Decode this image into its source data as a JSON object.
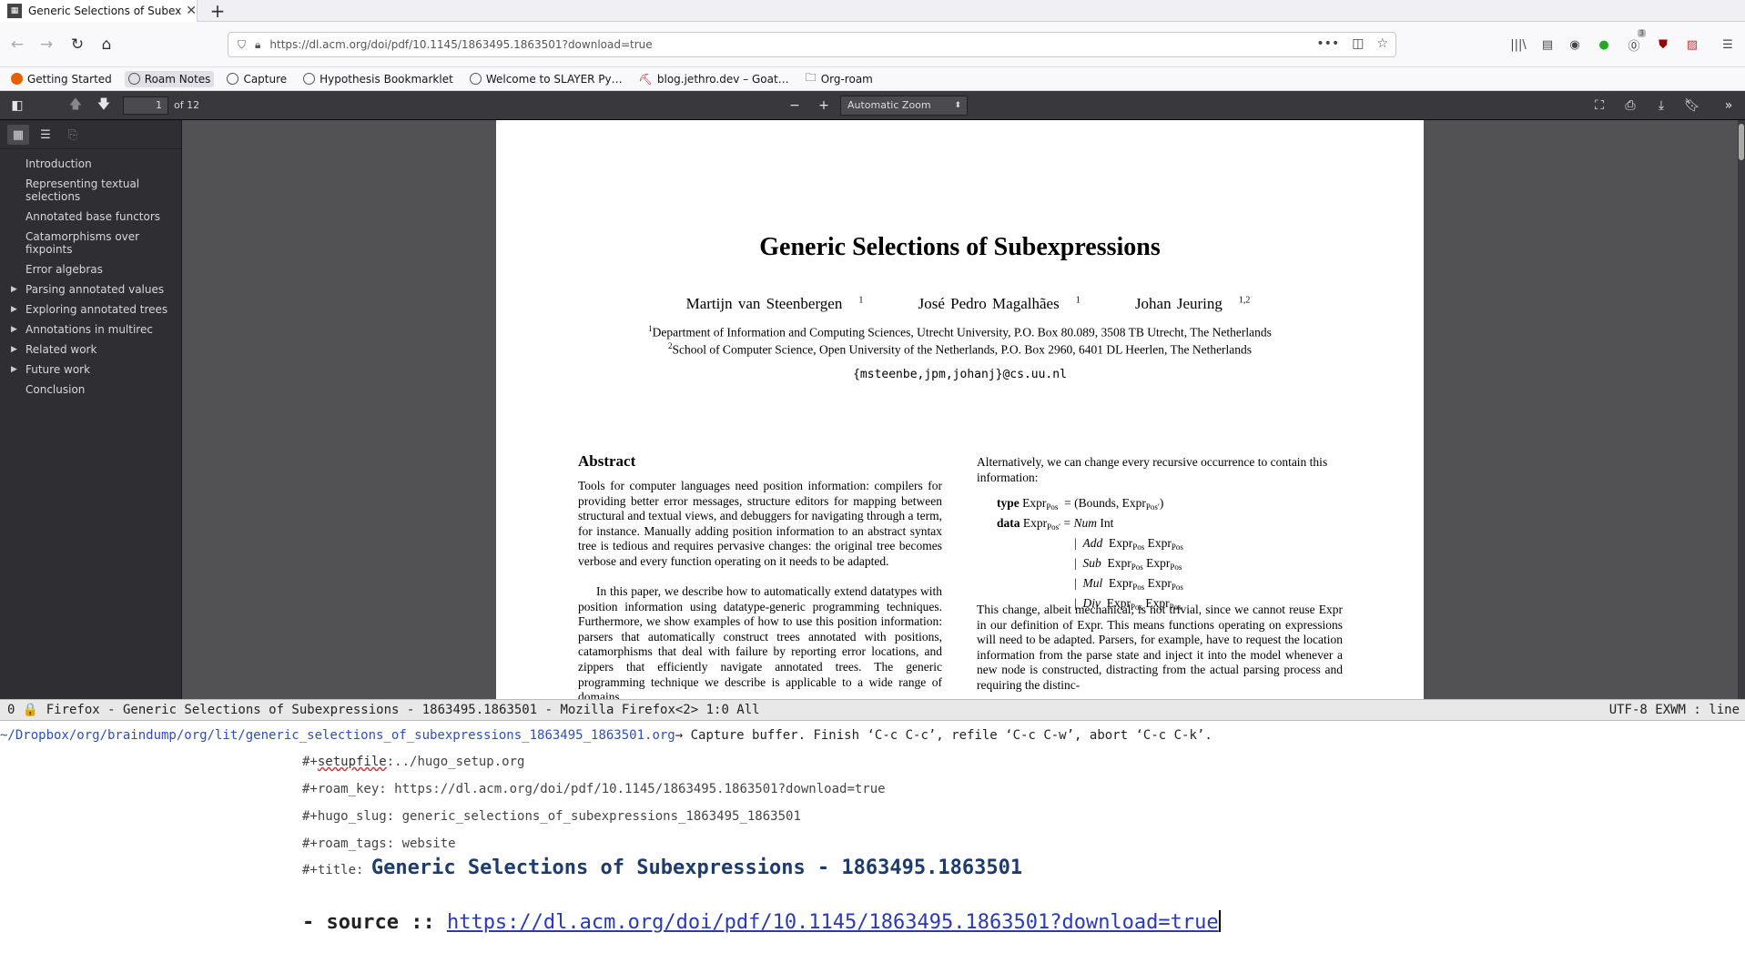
{
  "browser": {
    "tab_title": "Generic Selections of Subexpre",
    "url": "https://dl.acm.org/doi/pdf/10.1145/1863495.1863501?download=true",
    "bookmarks": [
      "Getting Started",
      "Roam Notes",
      "Capture",
      "Hypothesis Bookmarklet",
      "Welcome to SLAYER Py…",
      "blog.jethro.dev – Goat…",
      "Org-roam"
    ],
    "badge_count": "3"
  },
  "pdf": {
    "page_number": "1",
    "page_of": "of 12",
    "zoom": "Automatic Zoom",
    "outline": [
      {
        "label": "Introduction",
        "expandable": false
      },
      {
        "label": "Representing textual selections",
        "expandable": false
      },
      {
        "label": "Annotated base functors",
        "expandable": false
      },
      {
        "label": "Catamorphisms over fixpoints",
        "expandable": false
      },
      {
        "label": "Error algebras",
        "expandable": false
      },
      {
        "label": "Parsing annotated values",
        "expandable": true
      },
      {
        "label": "Exploring annotated trees",
        "expandable": true
      },
      {
        "label": "Annotations in multirec",
        "expandable": true
      },
      {
        "label": "Related work",
        "expandable": true
      },
      {
        "label": "Future work",
        "expandable": true
      },
      {
        "label": "Conclusion",
        "expandable": false
      }
    ],
    "paper": {
      "title": "Generic Selections of Subexpressions",
      "authors": [
        {
          "name": "Martijn van Steenbergen",
          "sup": "1"
        },
        {
          "name": "José Pedro Magalhães",
          "sup": "1"
        },
        {
          "name": "Johan Jeuring",
          "sup": "1,2"
        }
      ],
      "affiliation1": "Department of Information and Computing Sciences, Utrecht University, P.O. Box 80.089, 3508 TB Utrecht, The Netherlands",
      "affiliation2": "School of Computer Science, Open University of the Netherlands, P.O. Box 2960, 6401 DL Heerlen, The Netherlands",
      "email": "{msteenbe,jpm,johanj}@cs.uu.nl",
      "abstract_heading": "Abstract",
      "abstract_p1": "Tools for computer languages need position information: compilers for providing better error messages, structure editors for mapping between structural and textual views, and debuggers for navigating through a term, for instance. Manually adding position information to an abstract syntax tree is tedious and requires pervasive changes: the original tree becomes verbose and every function operating on it needs to be adapted.",
      "abstract_p2": "In this paper, we describe how to automatically extend datatypes with position information using datatype-generic programming techniques. Furthermore, we show examples of how to use this position information: parsers that automatically construct trees annotated with positions, catamorphisms that deal with failure by reporting error locations, and zippers that efficiently navigate annotated trees. The generic programming technique we describe is applicable to a wide range of domains.",
      "col2_p1": "Alternatively, we can change every recursive occurrence to contain this information:",
      "col2_p2": "This change, albeit mechanical, is not trivial, since we cannot reuse Expr in our definition of Expr. This means functions operating on expressions will need to be adapted. Parsers, for example, have to request the location information from the parse state and inject it into the model whenever a new node is constructed, distracting from the actual parsing process and requiring the distinc-"
    }
  },
  "modeline": {
    "left": "0  🔒 Firefox - Generic Selections of Subexpressions - 1863495.1863501 - Mozilla Firefox<2>  1:0 All",
    "right": "UTF-8  EXWM : line"
  },
  "capture": {
    "path": "~/Dropbox/org/braindump/org/lit/generic_selections_of_subexpressions_1863495_1863501.org",
    "message": " → Capture buffer.  Finish ‘C-c C-c’, refile ‘C-c C-w’, abort ‘C-c C-k’."
  },
  "org": {
    "setupfile_value": "../hugo_setup.org",
    "roam_key_value": "https://dl.acm.org/doi/pdf/10.1145/1863495.1863501?download=true",
    "hugo_slug_value": "generic_selections_of_subexpressions_1863495_1863501",
    "roam_tags_value": "website",
    "title_value": "Generic Selections of Subexpressions - 1863495.1863501",
    "source_prefix": "- source :: ",
    "source_link": "https://dl.acm.org/doi/pdf/10.1145/1863495.1863501?download=true"
  }
}
